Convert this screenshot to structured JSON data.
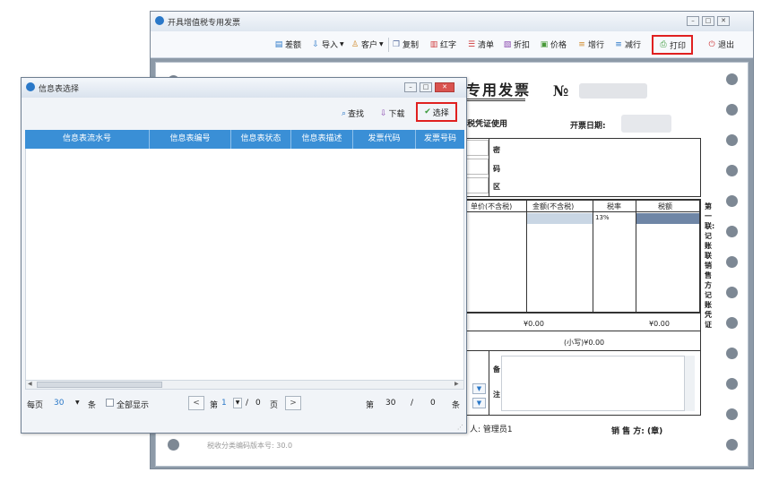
{
  "main_window": {
    "title": "开具增值税专用发票",
    "toolbar": {
      "diff": "差额",
      "import": "导入",
      "customer": "客户",
      "copy": "复制",
      "red": "红字",
      "list": "清单",
      "discount": "折扣",
      "price": "价格",
      "add_row": "增行",
      "del_row": "减行",
      "print": "打印",
      "exit": "退出"
    }
  },
  "invoice": {
    "title_fragment": "专用发票",
    "no_label": "№",
    "tax_usage": "税凭证使用",
    "issue_date_label": "开票日期:",
    "password_area": [
      "密",
      "码",
      "区"
    ],
    "columns": {
      "unit_price": "单价(不含税)",
      "amount": "金额(不含税)",
      "tax_rate": "税率",
      "tax": "税额"
    },
    "tax_rate_value": "13%",
    "amount_total": "¥0.00",
    "tax_total": "¥0.00",
    "small_caps": "(小写)¥0.00",
    "remarks": [
      "备",
      "注"
    ],
    "side_text": "第一联:记账联 销售方记账凭证",
    "drawer_label": "人: 管理员1",
    "seller_label": "销 售 方: (章)",
    "version": "税收分类编码版本号: 30.0"
  },
  "dialog": {
    "title": "信息表选择",
    "search_label": "查找",
    "download_label": "下载",
    "select_label": "选择",
    "columns": [
      "信息表流水号",
      "信息表编号",
      "信息表状态",
      "信息表描述",
      "发票代码",
      "发票号码"
    ],
    "pager": {
      "per_page_label": "每页",
      "per_page_value": "30",
      "unit": "条",
      "show_all": "全部显示",
      "page_prefix": "第",
      "current_page": "1",
      "page_sep": "/",
      "total_pages": "0",
      "page_suffix": "页",
      "range_prefix": "第",
      "range_start": "30",
      "range_sep": "/",
      "range_total": "0",
      "range_unit": "条"
    }
  },
  "colors": {
    "grid_header": "#3a8fd6",
    "highlight": "#e02020",
    "window_frame": "#8d9aa8"
  }
}
